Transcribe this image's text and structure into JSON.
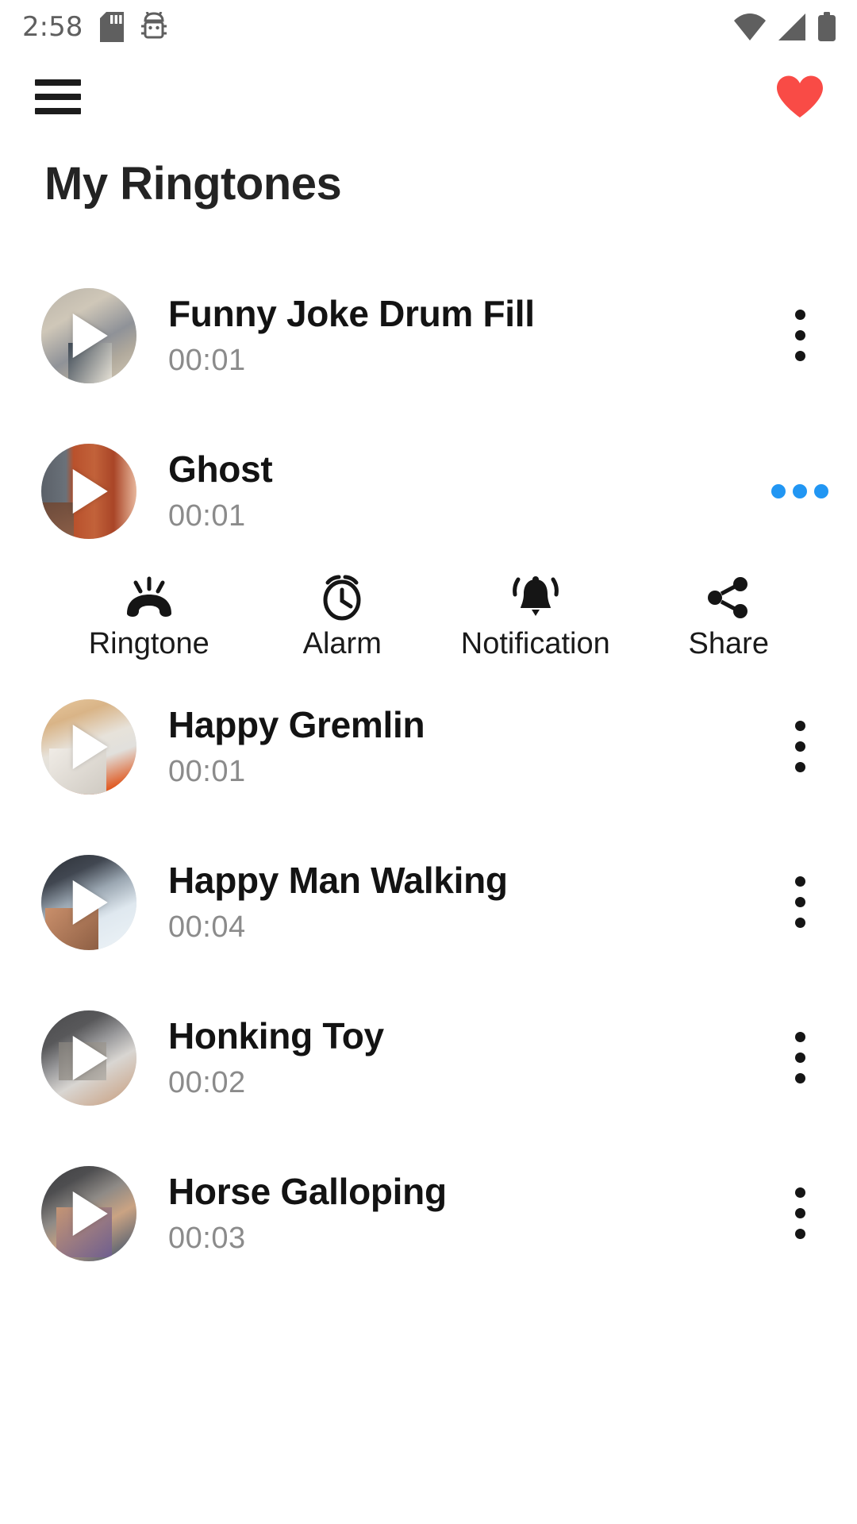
{
  "status_bar": {
    "time": "2:58",
    "left_icons": [
      "sd-card-icon",
      "usb-debug-icon"
    ],
    "right_icons": [
      "wifi-icon",
      "cellular-signal-icon",
      "battery-icon"
    ],
    "icon_color": "#5f5f5f"
  },
  "app_bar": {
    "menu_icon": "hamburger-menu-icon",
    "favorite_icon": "heart-icon",
    "favorite_color": "#F94B46"
  },
  "page": {
    "title": "My Ringtones"
  },
  "accent": {
    "expanded_dots": "#2196F3",
    "dots": "#151515"
  },
  "expanded_actions": [
    {
      "label": "Ringtone",
      "icon": "ringing-phone-icon"
    },
    {
      "label": "Alarm",
      "icon": "alarm-clock-icon"
    },
    {
      "label": "Notification",
      "icon": "ringing-bell-icon"
    },
    {
      "label": "Share",
      "icon": "share-icon"
    }
  ],
  "ringtones": [
    {
      "title": "Funny Joke Drum Fill",
      "duration": "00:01",
      "art": "art-sand",
      "expanded": false,
      "overflow_icon": "more-vertical-icon"
    },
    {
      "title": "Ghost",
      "duration": "00:01",
      "art": "art-brick",
      "expanded": true,
      "overflow_icon": "more-horizontal-icon"
    },
    {
      "title": "Happy Gremlin",
      "duration": "00:01",
      "art": "art-gremlin",
      "expanded": false,
      "overflow_icon": "more-vertical-icon"
    },
    {
      "title": "Happy Man Walking",
      "duration": "00:04",
      "art": "art-walk",
      "expanded": false,
      "overflow_icon": "more-vertical-icon"
    },
    {
      "title": "Honking Toy",
      "duration": "00:02",
      "art": "art-honk",
      "expanded": false,
      "overflow_icon": "more-vertical-icon"
    },
    {
      "title": "Horse Galloping",
      "duration": "00:03",
      "art": "art-horse",
      "expanded": false,
      "overflow_icon": "more-vertical-icon"
    }
  ]
}
